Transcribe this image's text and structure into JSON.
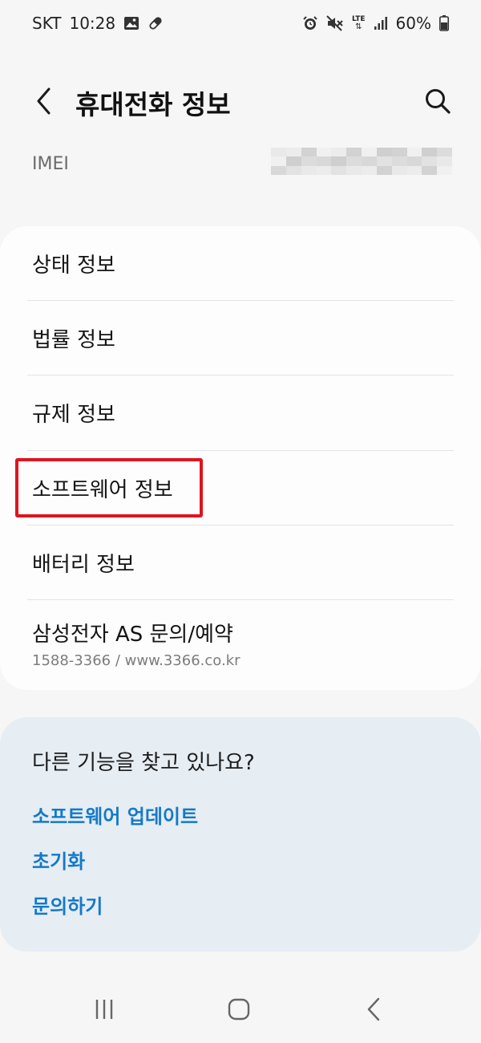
{
  "status_bar": {
    "carrier": "SKT",
    "time": "10:28",
    "network": "LTE",
    "battery": "60%",
    "icons_left": [
      "gallery-icon",
      "pill-icon"
    ],
    "icons_right": [
      "alarm-icon",
      "mute-icon",
      "lte-icon",
      "signal-icon",
      "battery-icon"
    ]
  },
  "header": {
    "title": "휴대전화 정보",
    "back_icon": "chevron-left-icon",
    "search_icon": "search-icon"
  },
  "imei": {
    "label": "IMEI",
    "value_masked": true
  },
  "menu": {
    "items": [
      {
        "label": "상태 정보"
      },
      {
        "label": "법률 정보"
      },
      {
        "label": "규제 정보"
      },
      {
        "label": "소프트웨어 정보",
        "highlighted": true
      },
      {
        "label": "배터리 정보"
      },
      {
        "label": "삼성전자 AS 문의/예약",
        "sub": "1588-3366 / www.3366.co.kr"
      }
    ]
  },
  "suggestions": {
    "title": "다른 기능을 찾고 있나요?",
    "links": [
      "소프트웨어 업데이트",
      "초기화",
      "문의하기"
    ]
  },
  "nav_bar": {
    "recents_icon": "recent-apps-icon",
    "home_icon": "home-icon",
    "back_icon": "back-icon"
  },
  "colors": {
    "background": "#f6f6f6",
    "card": "#fdfdfd",
    "suggest_card": "#e6edf3",
    "link": "#1479c8",
    "highlight": "#e0141e"
  }
}
